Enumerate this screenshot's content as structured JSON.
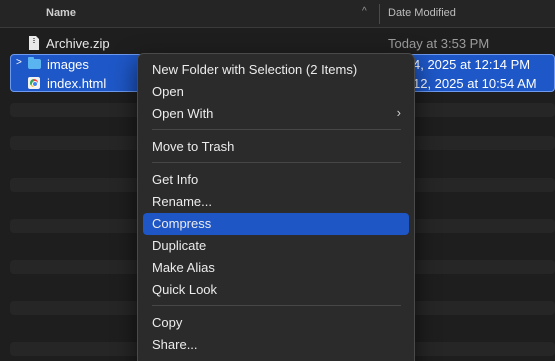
{
  "header": {
    "name": "Name",
    "date_modified": "Date Modified"
  },
  "files": [
    {
      "name": "Archive.zip",
      "date": "Today at 3:53 PM"
    }
  ],
  "selection": [
    {
      "name": "images",
      "date": "4, 2025 at 12:14 PM",
      "type": "folder"
    },
    {
      "name": "index.html",
      "date": "12, 2025 at 10:54 AM",
      "type": "html"
    }
  ],
  "menu": {
    "new_folder": "New Folder with Selection (2 Items)",
    "open": "Open",
    "open_with": "Open With",
    "trash": "Move to Trash",
    "get_info": "Get Info",
    "rename": "Rename...",
    "compress": "Compress",
    "duplicate": "Duplicate",
    "make_alias": "Make Alias",
    "quick_look": "Quick Look",
    "copy": "Copy",
    "share": "Share..."
  },
  "colors": {
    "selection": "#1e57c7",
    "highlight": "#1e56c6",
    "background": "#1e1e1e"
  }
}
